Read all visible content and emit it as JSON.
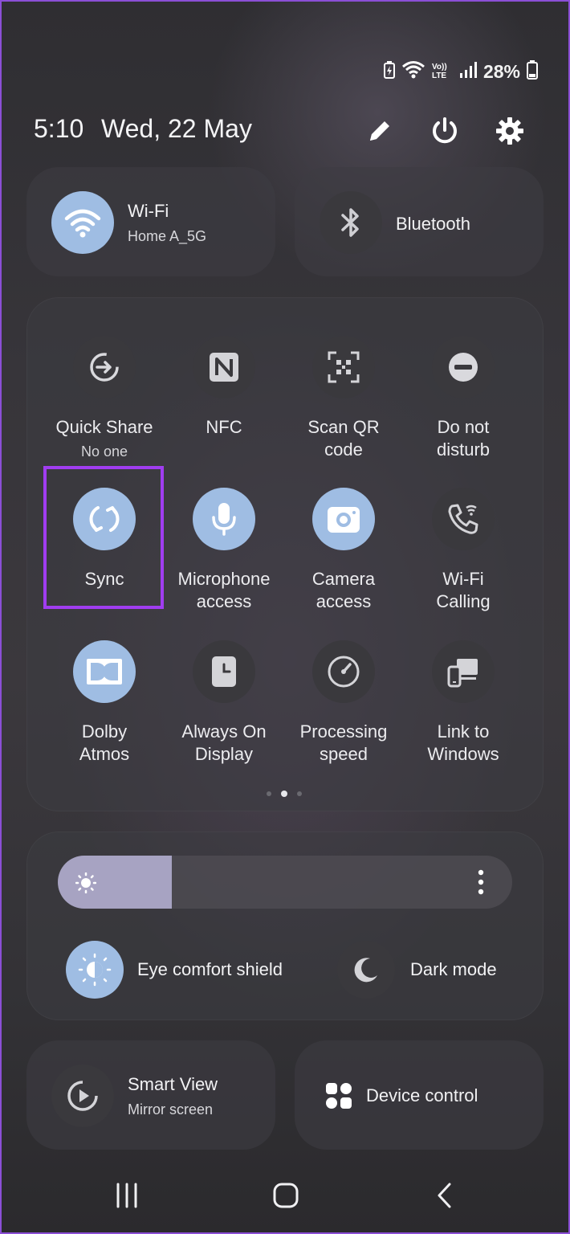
{
  "status_bar": {
    "battery_percent": "28%",
    "icons": [
      "battery-saver-icon",
      "wifi-signal-icon",
      "volte-icon",
      "cell-signal-icon",
      "battery-icon"
    ],
    "volte_text": "Vo)) LTE"
  },
  "header": {
    "time": "5:10",
    "date": "Wed, 22 May",
    "icons": [
      "edit-pencil-icon",
      "power-icon",
      "settings-gear-icon"
    ]
  },
  "wifi_tile": {
    "title": "Wi-Fi",
    "subtitle": "Home A_5G",
    "state": "on",
    "icon": "wifi-icon"
  },
  "bluetooth_tile": {
    "title": "Bluetooth",
    "state": "off",
    "icon": "bluetooth-icon"
  },
  "quick_tiles": [
    {
      "label": "Quick Share",
      "sub": "No one",
      "state": "off",
      "icon": "quick-share-icon"
    },
    {
      "label": "NFC",
      "state": "off",
      "icon": "nfc-icon"
    },
    {
      "label": "Scan QR code",
      "line1": "Scan QR",
      "line2": "code",
      "state": "off",
      "icon": "qr-scan-icon"
    },
    {
      "label": "Do not disturb",
      "line1": "Do not",
      "line2": "disturb",
      "state": "off",
      "icon": "do-not-disturb-icon"
    },
    {
      "label": "Sync",
      "state": "on",
      "icon": "sync-icon"
    },
    {
      "label": "Microphone access",
      "line1": "Microphone",
      "line2": "access",
      "state": "on",
      "icon": "microphone-icon"
    },
    {
      "label": "Camera access",
      "line1": "Camera",
      "line2": "access",
      "state": "on",
      "icon": "camera-icon"
    },
    {
      "label": "Wi-Fi Calling",
      "line1": "Wi-Fi",
      "line2": "Calling",
      "state": "off",
      "icon": "wifi-calling-icon"
    },
    {
      "label": "Dolby Atmos",
      "line1": "Dolby",
      "line2": "Atmos",
      "state": "on",
      "icon": "dolby-icon"
    },
    {
      "label": "Always On Display",
      "line1": "Always On",
      "line2": "Display",
      "state": "off",
      "icon": "always-on-display-icon"
    },
    {
      "label": "Processing speed",
      "line1": "Processing",
      "line2": "speed",
      "state": "off",
      "icon": "processing-speed-icon"
    },
    {
      "label": "Link to Windows",
      "line1": "Link to",
      "line2": "Windows",
      "state": "off",
      "icon": "link-to-windows-icon"
    }
  ],
  "pagination": {
    "pages": 3,
    "active_page": 2
  },
  "brightness": {
    "level_fraction": 0.25,
    "icons": [
      "sun-icon",
      "more-options-icon"
    ]
  },
  "eye_comfort": {
    "label": "Eye comfort shield",
    "state": "on",
    "icon": "eye-comfort-icon"
  },
  "dark_mode": {
    "label": "Dark mode",
    "state": "off",
    "icon": "moon-icon"
  },
  "smart_view": {
    "title": "Smart View",
    "subtitle": "Mirror screen",
    "icon": "smart-view-icon"
  },
  "device_control": {
    "title": "Device control",
    "icon": "device-control-icon"
  },
  "nav_bar": {
    "buttons": [
      "recents-button",
      "home-button",
      "back-button"
    ]
  },
  "colors": {
    "tile_on": "#9fbde3",
    "tile_off": "#3a393d",
    "highlight": "#a03df0"
  }
}
